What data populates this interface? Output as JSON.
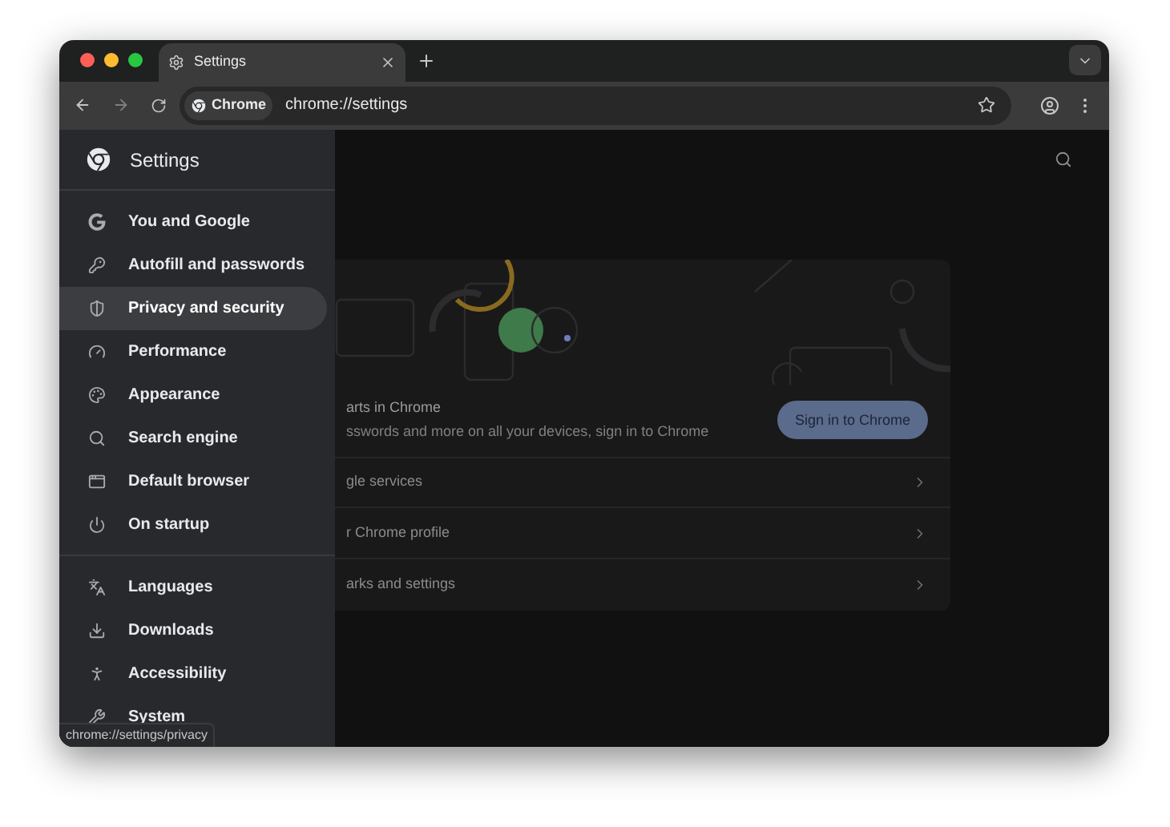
{
  "window": {
    "tab": {
      "title": "Settings"
    },
    "address_bar": {
      "chip": "Chrome",
      "url": "chrome://settings"
    }
  },
  "drawer": {
    "title": "Settings",
    "groups": [
      [
        {
          "label": "You and Google",
          "selected": false
        },
        {
          "label": "Autofill and passwords",
          "selected": false
        },
        {
          "label": "Privacy and security",
          "selected": true
        },
        {
          "label": "Performance",
          "selected": false
        },
        {
          "label": "Appearance",
          "selected": false
        },
        {
          "label": "Search engine",
          "selected": false
        },
        {
          "label": "Default browser",
          "selected": false
        },
        {
          "label": "On startup",
          "selected": false
        }
      ],
      [
        {
          "label": "Languages",
          "selected": false
        },
        {
          "label": "Downloads",
          "selected": false
        },
        {
          "label": "Accessibility",
          "selected": false
        },
        {
          "label": "System",
          "selected": false
        }
      ]
    ]
  },
  "card": {
    "heading": "arts in Chrome",
    "subtext": "sswords and more on all your devices, sign in to Chrome",
    "button": "Sign in to Chrome",
    "rows": [
      "gle services",
      "r Chrome profile",
      "arks and settings"
    ]
  },
  "status_bubble": "chrome://settings/privacy"
}
